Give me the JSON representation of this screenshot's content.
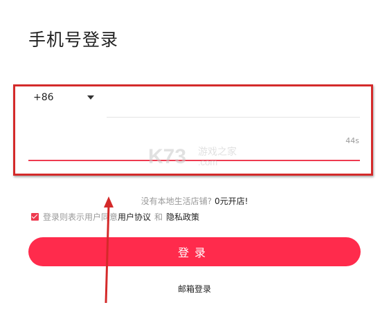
{
  "page": {
    "title": "手机号登录"
  },
  "phone": {
    "country_code": "+86",
    "value": "",
    "placeholder": ""
  },
  "code": {
    "value": "",
    "placeholder": "",
    "countdown": "44s"
  },
  "watermark": {
    "text": "游戏之家",
    "sub": ".com",
    "logo": "K73"
  },
  "signup_prompt": {
    "text": "没有本地生活店铺?",
    "link": "0元开店!"
  },
  "agreement": {
    "checked": true,
    "text": "登录则表示用户同意",
    "user_agreement": "用户协议",
    "and": "和",
    "privacy_policy": "隐私政策"
  },
  "login_button": {
    "label": "登录"
  },
  "email_login": {
    "label": "邮箱登录"
  },
  "colors": {
    "accent": "#ff2b4c",
    "annotation": "#d42a2a"
  }
}
